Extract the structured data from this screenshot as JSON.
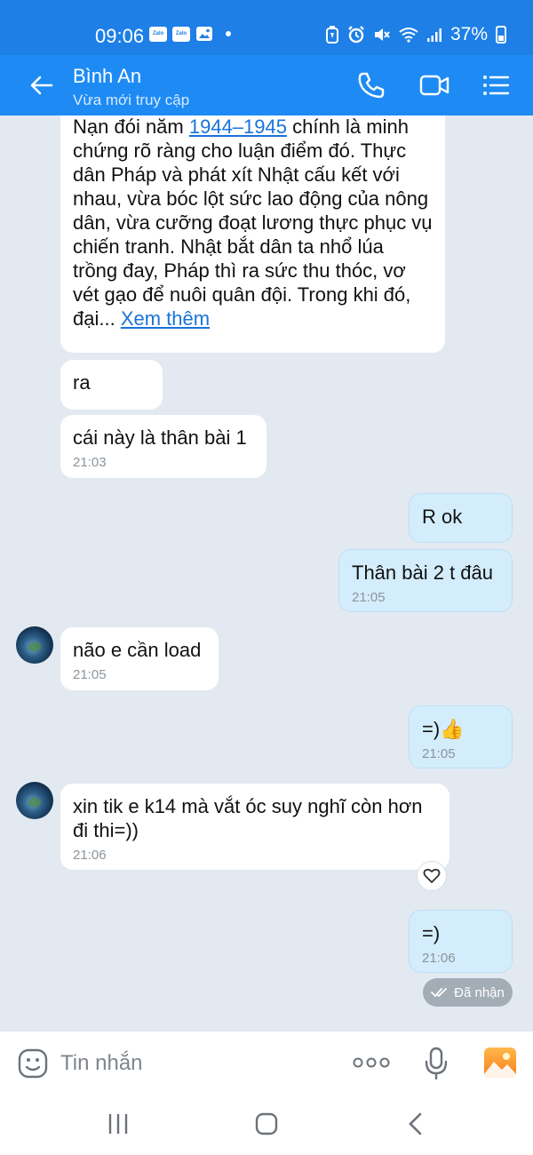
{
  "status_bar": {
    "time": "09:06",
    "notif_badges": [
      "Zalo",
      "Zalo"
    ],
    "battery": "37%"
  },
  "header": {
    "contact_name": "Bình An",
    "contact_status": "Vừa mới truy cập"
  },
  "messages": {
    "m1": {
      "sender": "contact",
      "line_before": "Nạn đói năm ",
      "link": "1944–1945",
      "line_after": " chính là minh chứng rõ ràng cho luận điểm đó. Thực dân Pháp và phát xít Nhật cấu kết với nhau, vừa bóc lột sức lao động của nông dân, vừa cưỡng đoạt lương thực phục vụ chiến tranh. Nhật bắt dân ta nhổ lúa trồng đay, Pháp thì ra sức thu thóc, vơ vét gạo để nuôi quân đội. Trong khi đó, đại... ",
      "see_more": "Xem thêm"
    },
    "m2": {
      "sender": "contact",
      "text": "ra"
    },
    "m3": {
      "sender": "contact",
      "text": "cái này là thân bài 1",
      "time": "21:03"
    },
    "m4": {
      "sender": "me",
      "text": "R ok"
    },
    "m5": {
      "sender": "me",
      "text": "Thân bài 2 t đâu",
      "time": "21:05"
    },
    "m6": {
      "sender": "contact",
      "text": "não e cần load",
      "time": "21:05"
    },
    "m7": {
      "sender": "me",
      "text": "=)👍",
      "time": "21:05"
    },
    "m8": {
      "sender": "contact",
      "text": "xin tik e k14 mà vắt óc suy nghĩ còn hơn đi thi=))",
      "time": "21:06"
    },
    "m9": {
      "sender": "me",
      "text": "=)",
      "time": "21:06"
    }
  },
  "received_status": "Đã nhận",
  "input": {
    "placeholder": "Tin nhắn"
  },
  "icons": {
    "back": "arrow-left-icon",
    "call": "phone-icon",
    "video": "video-camera-icon",
    "menu": "list-menu-icon",
    "sticker": "smiley-icon",
    "more": "more-dots-icon",
    "mic": "microphone-icon",
    "gallery": "image-gallery-icon",
    "react": "heart-icon"
  },
  "colors": {
    "header_bg": "#1e8bf5",
    "chat_bg": "#e2e9f1",
    "my_bubble": "#d4edfc",
    "link": "#1a73d9"
  }
}
